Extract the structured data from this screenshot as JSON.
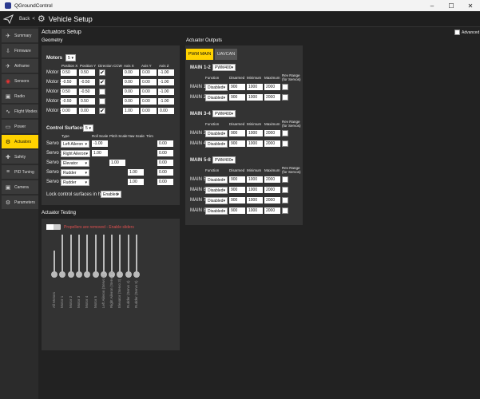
{
  "window": {
    "title": "QGroundControl"
  },
  "toolbar": {
    "back_label": "Back",
    "lt": "<",
    "title": "Vehicle Setup"
  },
  "sidebar": {
    "items": [
      {
        "label": "Summary"
      },
      {
        "label": "Firmware"
      },
      {
        "label": "Airframe"
      },
      {
        "label": "Sensors"
      },
      {
        "label": "Radio"
      },
      {
        "label": "Flight Modes"
      },
      {
        "label": "Power"
      },
      {
        "label": "Actuators"
      },
      {
        "label": "Safety"
      },
      {
        "label": "PID Tuning"
      },
      {
        "label": "Camera"
      },
      {
        "label": "Parameters"
      }
    ]
  },
  "page": {
    "title": "Actuators Setup",
    "advanced_label": "Advanced",
    "geometry": "Geometry",
    "testing": "Actuator Testing",
    "outputs": "Actuator Outputs"
  },
  "motors": {
    "label": "Motors",
    "count": "5",
    "headers": [
      "Position X",
      "Position Y",
      "Direction CCW",
      "Axis X",
      "Axis Y",
      "Axis Z"
    ],
    "rows": [
      {
        "name": "Motor 1:",
        "x": "0.50",
        "y": "0.50",
        "ccw": true,
        "ax": "0.00",
        "ay": "0.00",
        "az": "-1.00"
      },
      {
        "name": "Motor 2:",
        "x": "-0.50",
        "y": "-0.50",
        "ccw": true,
        "ax": "0.00",
        "ay": "0.00",
        "az": "-1.00"
      },
      {
        "name": "Motor 3:",
        "x": "0.50",
        "y": "-0.50",
        "ccw": false,
        "ax": "0.00",
        "ay": "0.00",
        "az": "-1.00"
      },
      {
        "name": "Motor 4:",
        "x": "-0.50",
        "y": "0.50",
        "ccw": false,
        "ax": "0.00",
        "ay": "0.00",
        "az": "-1.00"
      },
      {
        "name": "Motor 5:",
        "x": "0.00",
        "y": "0.00",
        "ccw": true,
        "ax": "1.00",
        "ay": "0.00",
        "az": "0.00"
      }
    ]
  },
  "surfaces": {
    "label": "Control Surfaces",
    "count": "5",
    "headers": [
      "Type",
      "Roll Scale",
      "Pitch Scale",
      "Yaw Scale",
      "Trim"
    ],
    "rows": [
      {
        "name": "Servo 1:",
        "type": "Left Aileron",
        "roll": "-1.00",
        "pitch": "",
        "yaw": "",
        "trim": "0.00"
      },
      {
        "name": "Servo 2:",
        "type": "Right Aileron",
        "roll": "1.00",
        "pitch": "",
        "yaw": "",
        "trim": "0.00"
      },
      {
        "name": "Servo 3:",
        "type": "Elevator",
        "roll": "",
        "pitch": "1.00",
        "yaw": "",
        "trim": "0.00"
      },
      {
        "name": "Servo 4:",
        "type": "Rudder",
        "roll": "",
        "pitch": "",
        "yaw": "1.00",
        "trim": "0.00"
      },
      {
        "name": "Servo 5:",
        "type": "Rudder",
        "roll": "",
        "pitch": "",
        "yaw": "1.00",
        "trim": "0.00"
      }
    ],
    "lock_label": "Lock control surfaces in hover:",
    "lock_value": "Enabled"
  },
  "testing": {
    "warning": "Propellers are removed - Enable sliders",
    "sliders": [
      "All Motors",
      "Motor 1",
      "Motor 2",
      "Motor 3",
      "Motor 4",
      "Motor 5",
      "Left Aileron (Servo 1)",
      "Right Aileron (Servo 2)",
      "Elevator (Servo 3)",
      "Rudder (Servo 4)",
      "Rudder (Servo 5)"
    ]
  },
  "outputs": {
    "tabs": [
      "PWM MAIN",
      "UAVCAN"
    ],
    "col_headers": {
      "function": "Function",
      "disarmed": "Disarmed",
      "minimum": "Minimum",
      "maximum": "Maximum",
      "rev": "Rev Range (for Servos)"
    },
    "groups": [
      {
        "name": "MAIN 1-2",
        "rate": "PWM400",
        "rows": [
          {
            "name": "MAIN 1:",
            "fn": "Disabled",
            "dis": "900",
            "min": "1000",
            "max": "2000"
          },
          {
            "name": "MAIN 2:",
            "fn": "Disabled",
            "dis": "900",
            "min": "1000",
            "max": "2000"
          }
        ]
      },
      {
        "name": "MAIN 3-4",
        "rate": "PWM400",
        "rows": [
          {
            "name": "MAIN 3:",
            "fn": "Disabled",
            "dis": "900",
            "min": "1000",
            "max": "2000"
          },
          {
            "name": "MAIN 4:",
            "fn": "Disabled",
            "dis": "900",
            "min": "1000",
            "max": "2000"
          }
        ]
      },
      {
        "name": "MAIN 5-8",
        "rate": "PWM400",
        "rows": [
          {
            "name": "MAIN 5:",
            "fn": "Disabled",
            "dis": "900",
            "min": "1000",
            "max": "2000"
          },
          {
            "name": "MAIN 6:",
            "fn": "Disabled",
            "dis": "900",
            "min": "1000",
            "max": "2000"
          },
          {
            "name": "MAIN 7:",
            "fn": "Disabled",
            "dis": "900",
            "min": "1000",
            "max": "2000"
          },
          {
            "name": "MAIN 8:",
            "fn": "Disabled",
            "dis": "900",
            "min": "1000",
            "max": "2000"
          }
        ]
      }
    ]
  },
  "colors": {
    "accent": "#ffd200",
    "warning": "#e05050",
    "panel": "#333333"
  }
}
